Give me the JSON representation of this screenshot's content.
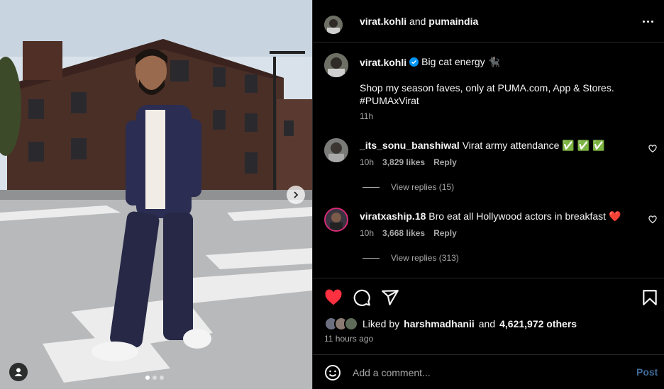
{
  "header": {
    "username": "virat.kohli",
    "joiner": "and",
    "collaborator": "pumaindia"
  },
  "caption": {
    "username": "virat.kohli",
    "headline": "Big cat energy 🐈‍⬛",
    "body_line1": "Shop my season faves, only at PUMA.com, App & Stores.",
    "body_line2": "#PUMAxVirat",
    "time": "11h"
  },
  "comments": [
    {
      "username": "_its_sonu_banshiwal",
      "text": "Virat army attendance ✅ ✅ ✅",
      "time": "10h",
      "likes": "3,829 likes",
      "reply_label": "Reply",
      "view_replies": "View replies (15)"
    },
    {
      "username": "viratxaship.18",
      "text": "Bro eat all Hollywood actors in breakfast ❤️",
      "time": "10h",
      "likes": "3,668 likes",
      "reply_label": "Reply",
      "view_replies": "View replies (313)"
    }
  ],
  "likes": {
    "prefix": "Liked by",
    "user": "harshmadhanii",
    "joiner": "and",
    "others": "4,621,972 others"
  },
  "post_time": "11 hours ago",
  "add_comment": {
    "placeholder": "Add a comment...",
    "post_label": "Post"
  },
  "carousel": {
    "slide_count": 3,
    "active_slide": 1
  },
  "colors": {
    "like_red": "#ff3040",
    "verified_blue": "#0095f6",
    "post_disabled": "#3f6b99",
    "muted_text": "#a8a8a8"
  },
  "icons": [
    "more-icon",
    "verified-icon",
    "heart-icon",
    "comment-icon",
    "share-icon",
    "bookmark-icon",
    "emoji-icon",
    "chevron-right-icon",
    "user-tag-icon"
  ]
}
